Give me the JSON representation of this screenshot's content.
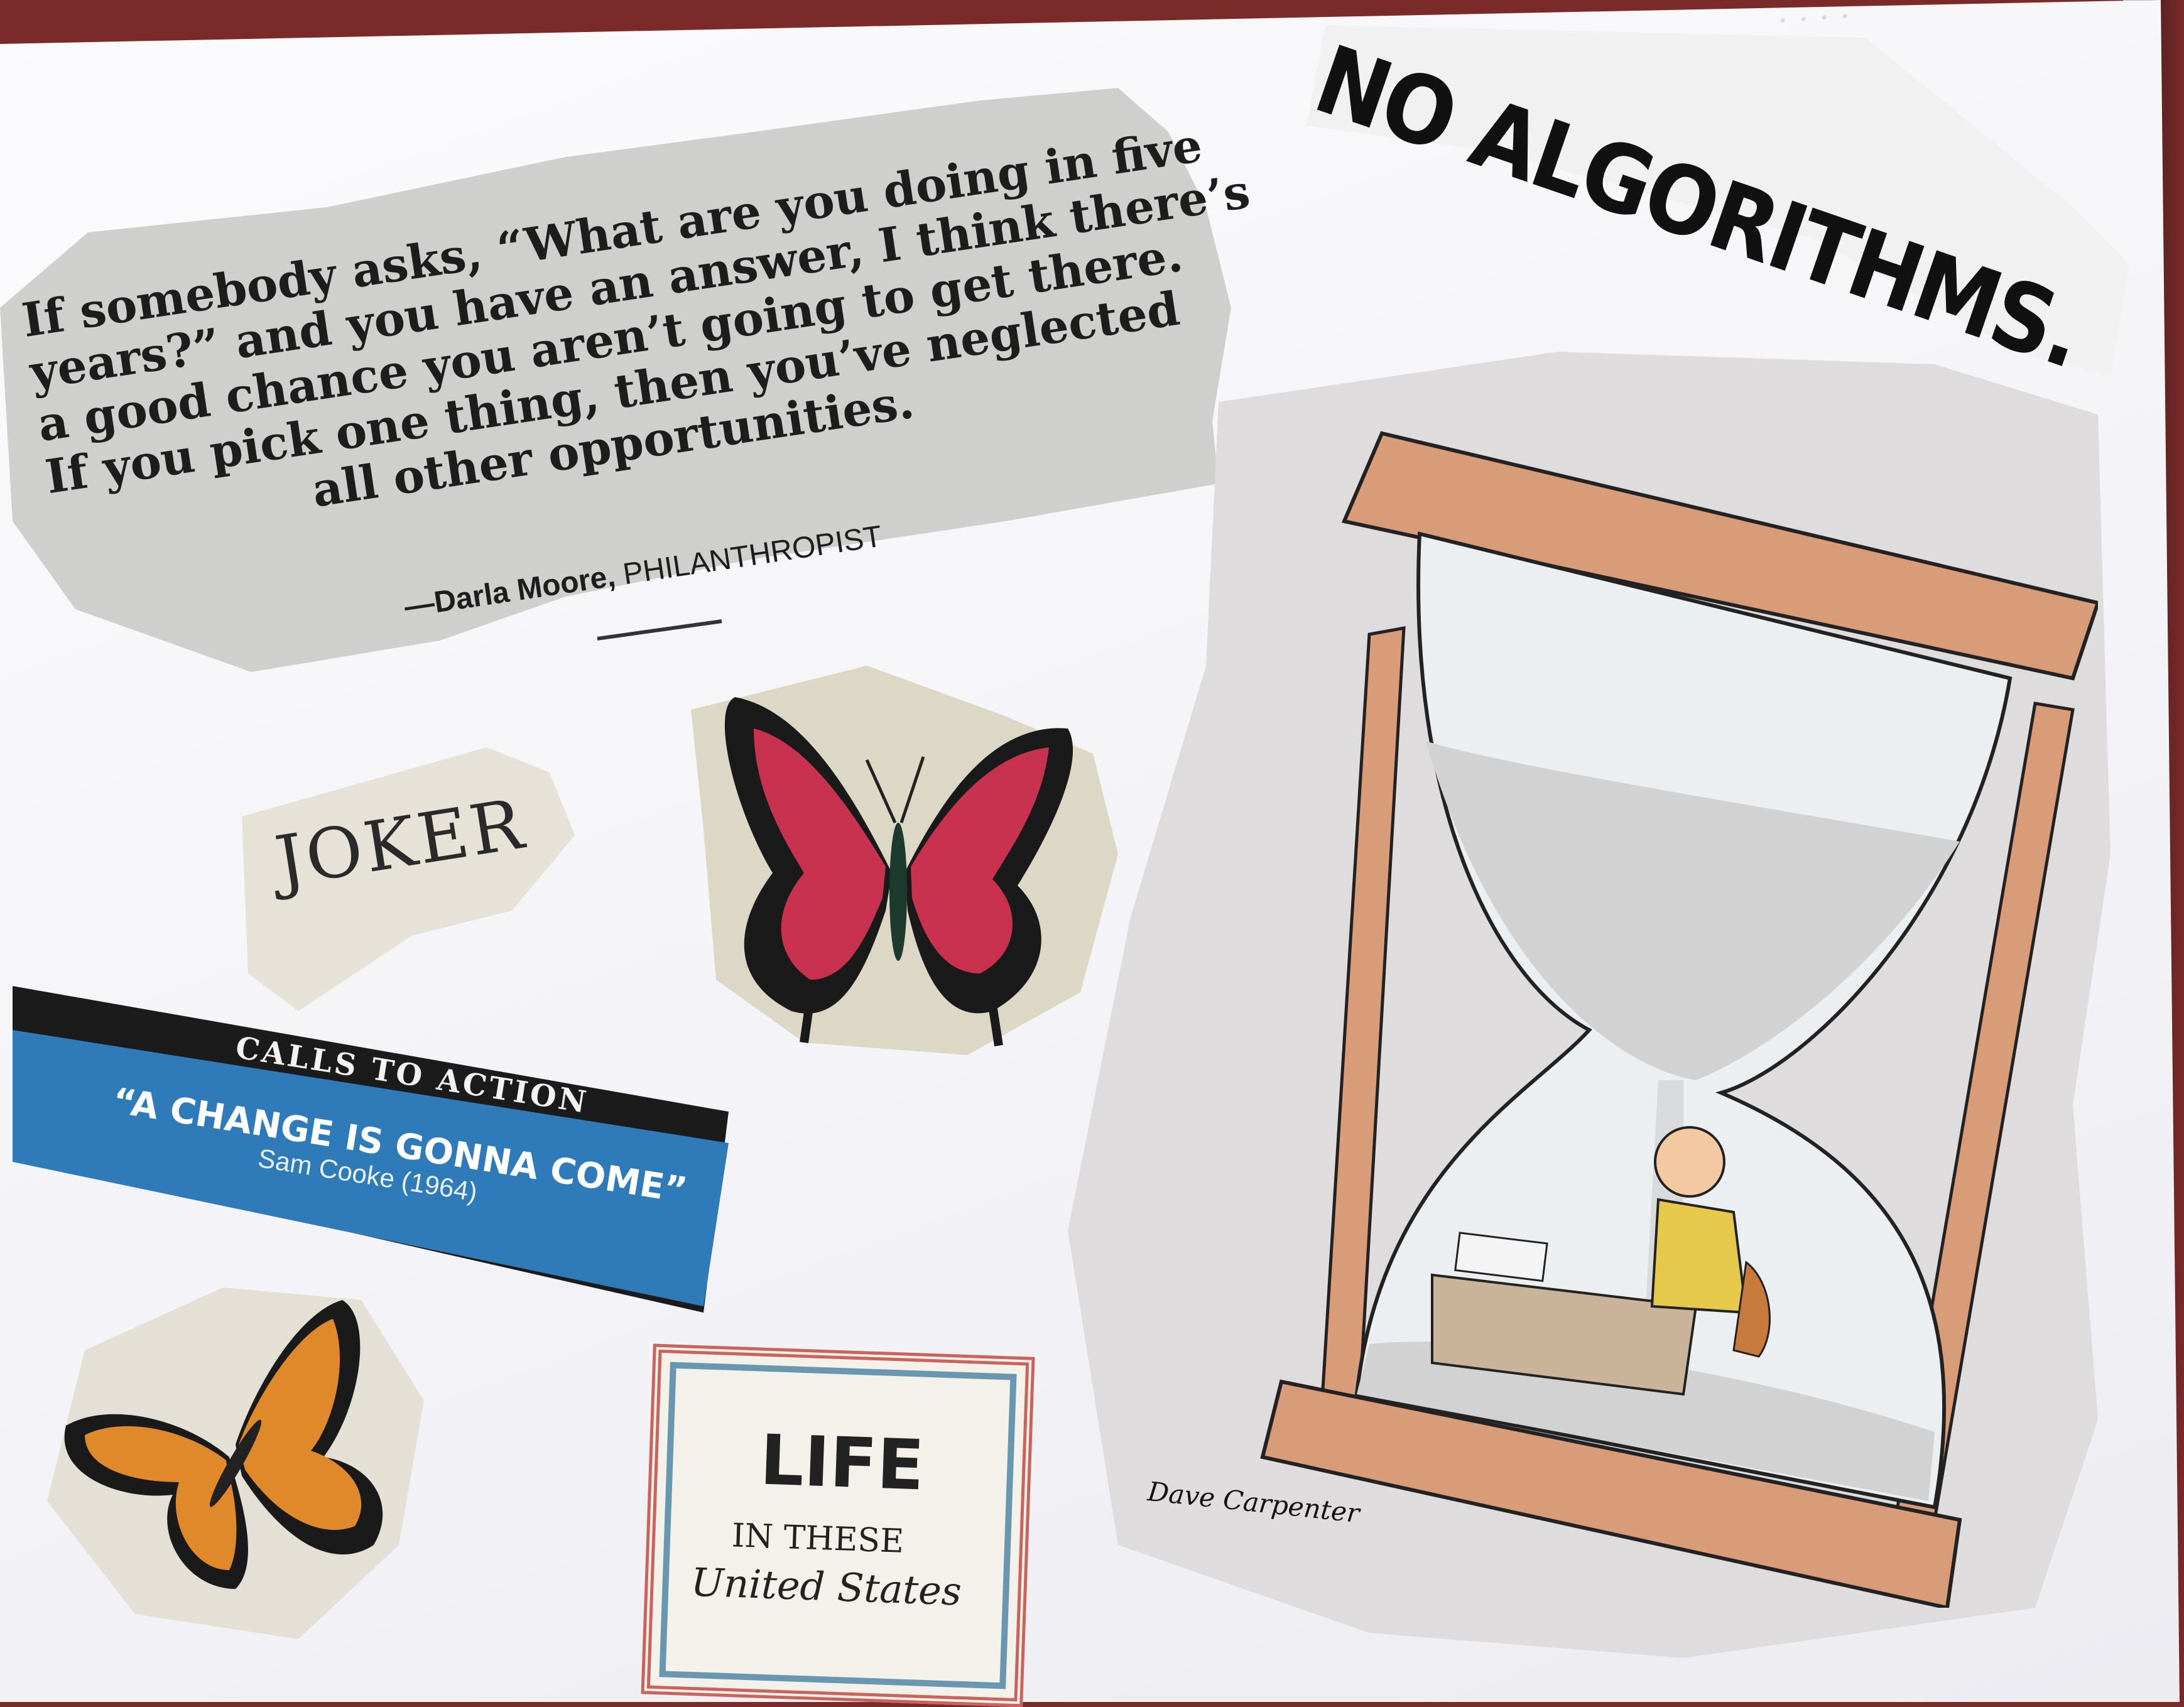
{
  "collage": {
    "quote": {
      "lines": [
        "If somebody asks, “What are you doing in five",
        "years?” and you have an answer, I think there’s",
        "a good chance you aren’t going to get there.",
        "If you pick one thing, then you’ve neglected",
        "all other opportunities."
      ],
      "author": "—Darla Moore,",
      "author_title": "PHILANTHROPIST"
    },
    "headline": "NO ALGORITHMS.",
    "joker": "JOKER",
    "calls_to_action": {
      "label": "CALLS TO ACTION",
      "title": "“A CHANGE IS GONNA COME”",
      "subtitle": "Sam Cooke (1964)"
    },
    "life_card": {
      "title": "LIFE",
      "line2": "IN THESE",
      "line3": "United States"
    },
    "cartoon": {
      "signature": "Dave Carpenter"
    },
    "colors": {
      "desk": "#7a2a28",
      "paper": "#f5f5f8",
      "cta_blue": "#2f7ab9",
      "butterfly_red": "#c8324f",
      "butterfly_orange": "#e0892a",
      "hourglass_wood": "#d99c78"
    },
    "icons": [
      "red-butterfly-icon",
      "monarch-butterfly-icon",
      "hourglass-icon"
    ]
  }
}
